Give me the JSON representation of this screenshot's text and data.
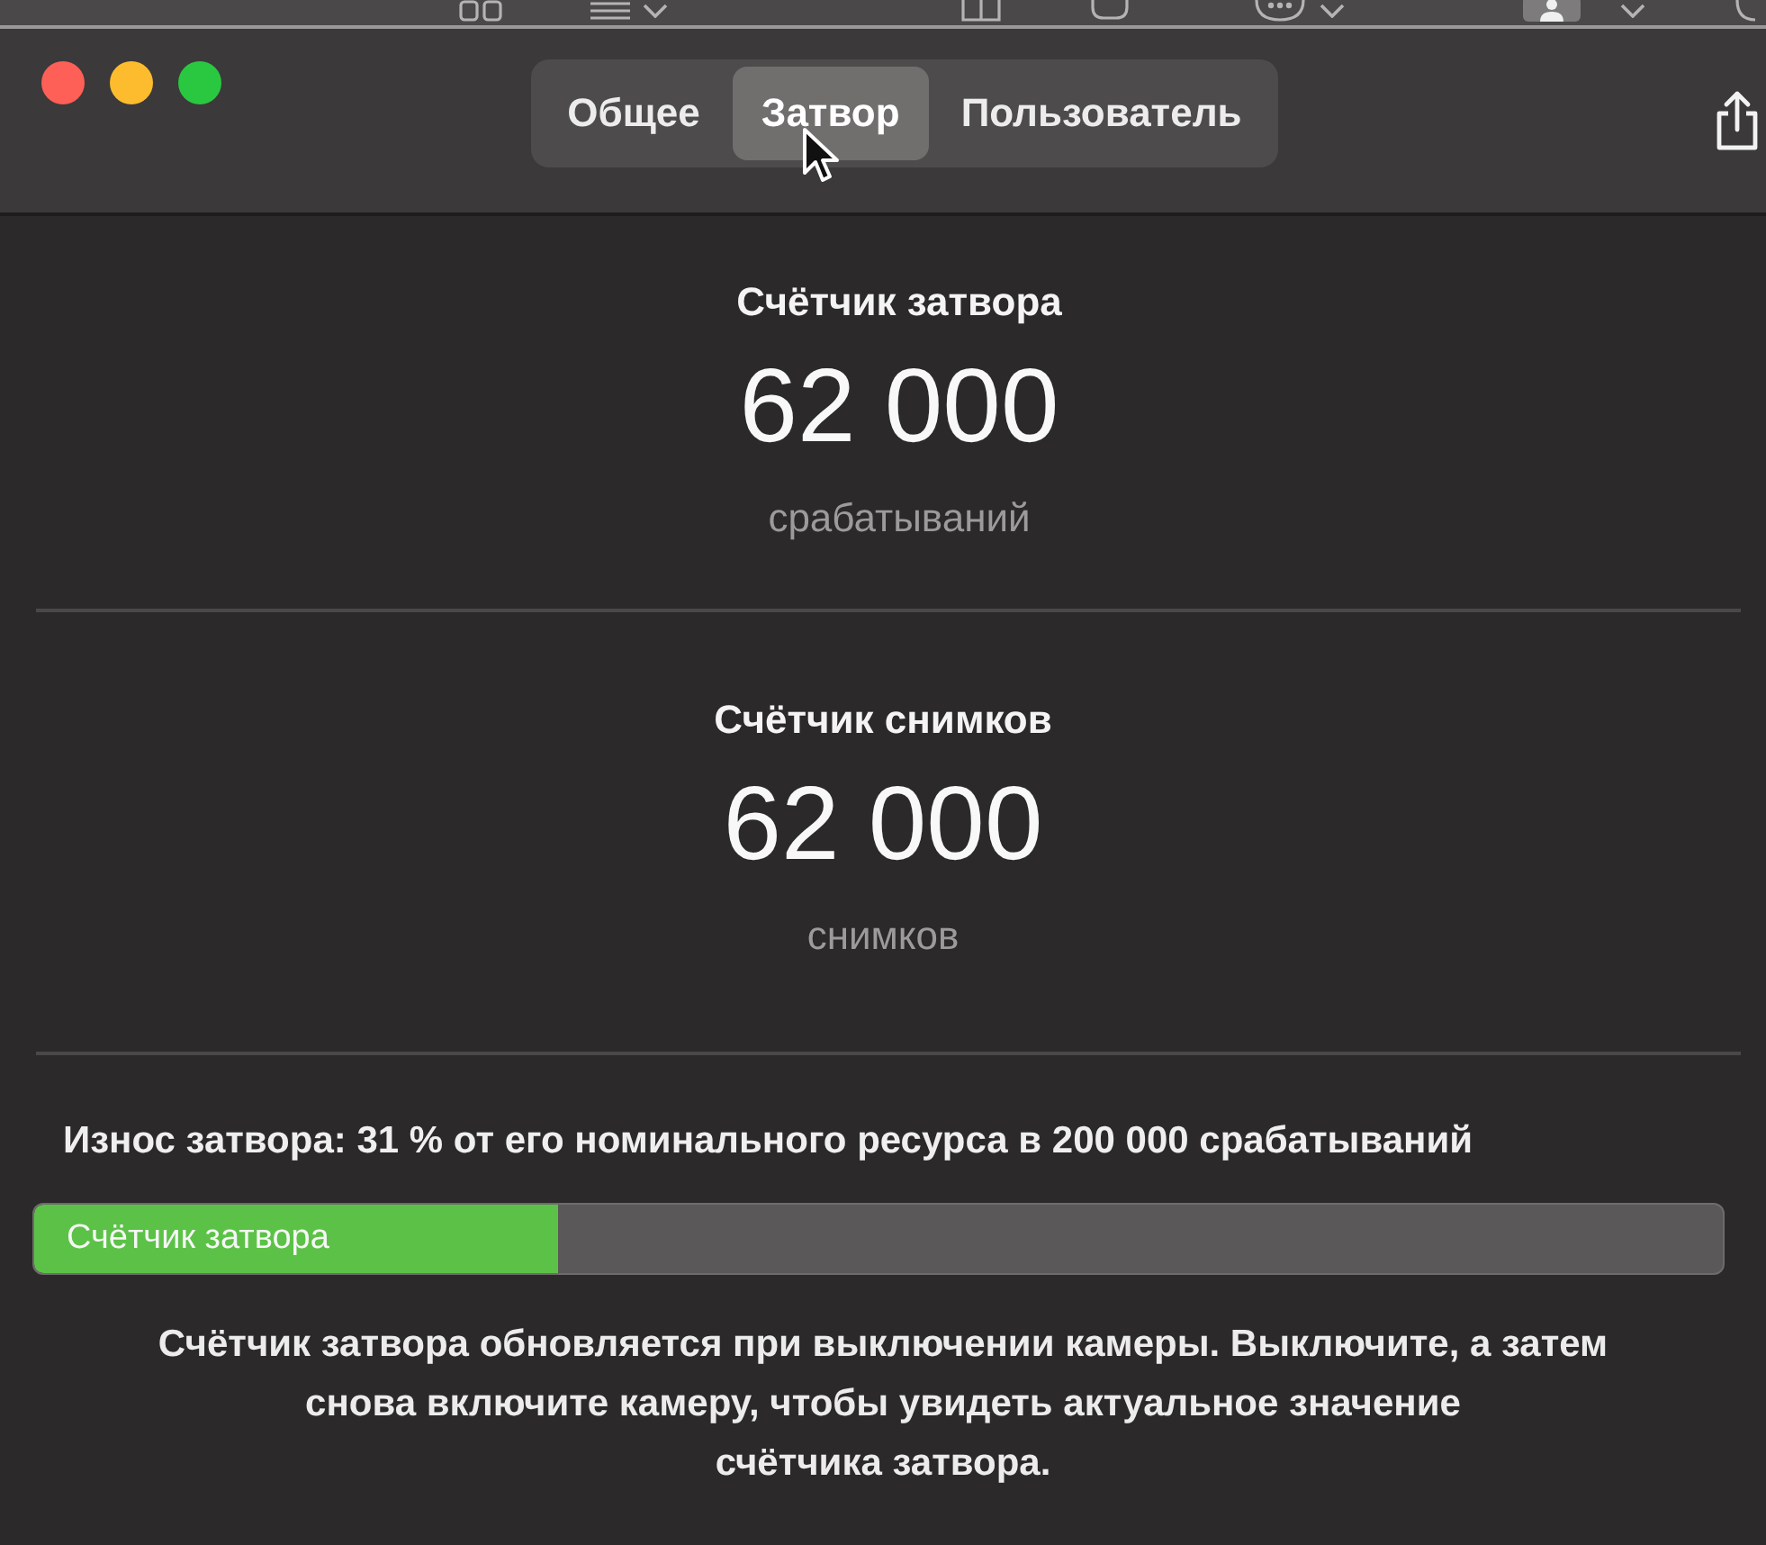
{
  "window": {
    "controls": [
      {
        "color": "#fe5f57"
      },
      {
        "color": "#fdbc2e"
      },
      {
        "color": "#2ac840"
      }
    ]
  },
  "tabs": [
    {
      "label": "Общее",
      "selected": false
    },
    {
      "label": "Затвор",
      "selected": true
    },
    {
      "label": "Пользователь",
      "selected": false
    }
  ],
  "counters": [
    {
      "title": "Счётчик затвора",
      "value": "62 000",
      "unit": "срабатываний"
    },
    {
      "title": "Счётчик снимков",
      "value": "62 000",
      "unit": "снимков"
    }
  ],
  "wear": {
    "text": "Износ затвора: 31 % от его номинального ресурса в 200 000 срабатываний",
    "bar": {
      "label": "Счётчик затвора",
      "level": 0.31
    }
  },
  "note": "Счётчик затвора обновляется при выключении камеры. Выключите, а затем\nснова включите камеру, чтобы увидеть актуальное значение\nсчётчика затвора."
}
